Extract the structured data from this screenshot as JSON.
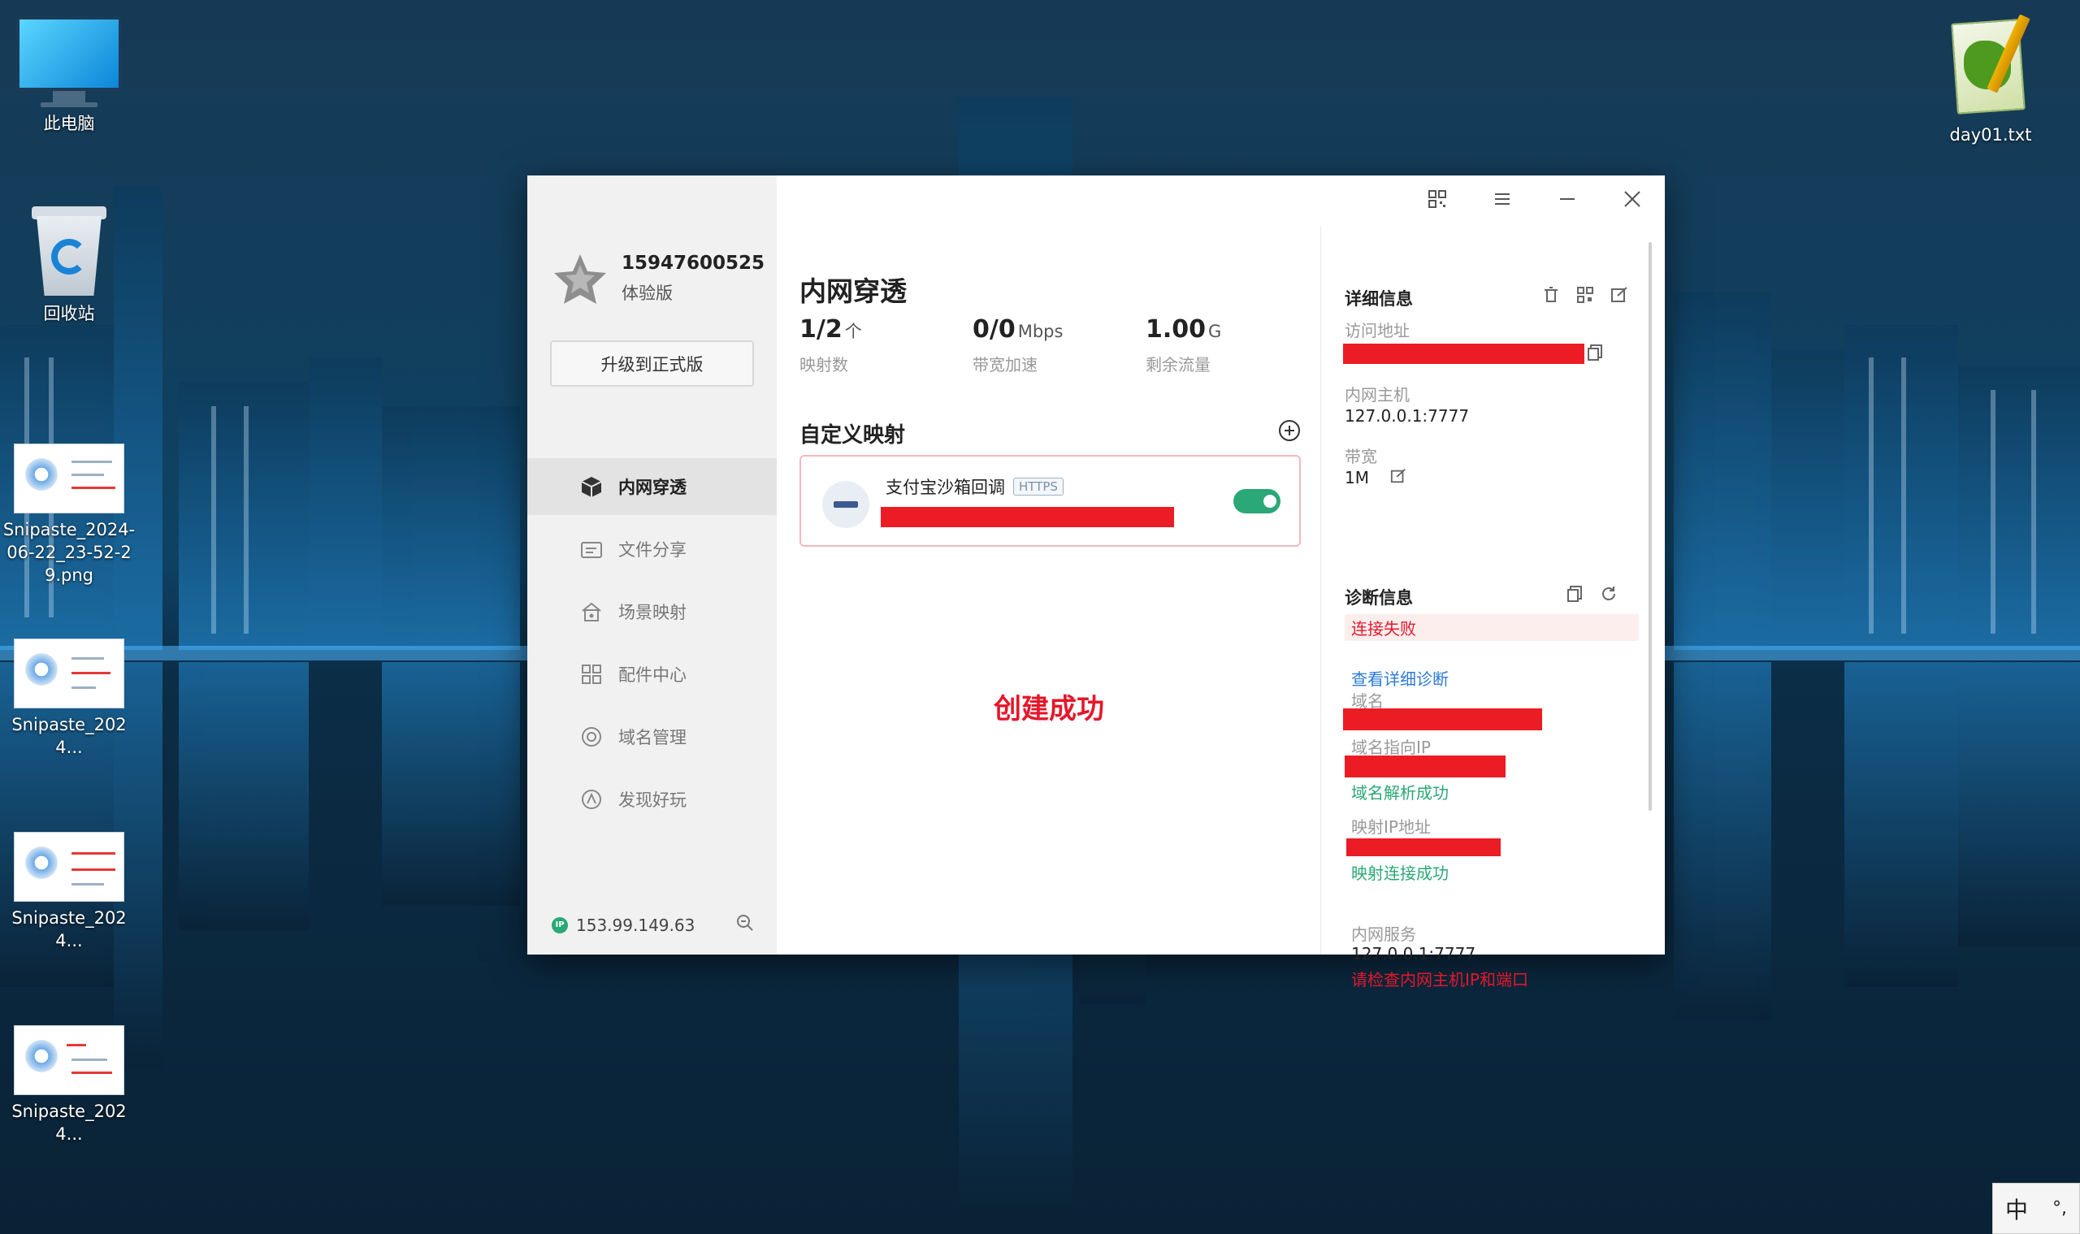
{
  "desktop": {
    "icons": [
      {
        "label": "此电脑"
      },
      {
        "label": "回收站"
      },
      {
        "label": "Snipaste_2024-06-22_23-52-29.png"
      },
      {
        "label": "Snipaste_2024..."
      },
      {
        "label": "Snipaste_2024..."
      },
      {
        "label": "Snipaste_2024..."
      },
      {
        "label": "day01.txt"
      }
    ]
  },
  "app": {
    "profile": {
      "uid": "15947600525",
      "tier": "体验版"
    },
    "upgrade_label": "升级到正式版",
    "nav": [
      {
        "label": "内网穿透",
        "icon": "cube-icon",
        "active": true
      },
      {
        "label": "文件分享",
        "icon": "folder-share-icon"
      },
      {
        "label": "场景映射",
        "icon": "home-scene-icon"
      },
      {
        "label": "配件中心",
        "icon": "grid-apps-icon"
      },
      {
        "label": "域名管理",
        "icon": "domain-icon"
      },
      {
        "label": "发现好玩",
        "icon": "discover-icon"
      }
    ],
    "footer": {
      "ip_badge": "IP",
      "ip": "153.99.149.63"
    },
    "main": {
      "title": "内网穿透",
      "stats": [
        {
          "value": "1/2",
          "unit": "个",
          "label": "映射数"
        },
        {
          "value": "0/0",
          "unit": "Mbps",
          "label": "带宽加速"
        },
        {
          "value": "1.00",
          "unit": "G",
          "label": "剩余流量"
        }
      ],
      "section_title": "自定义映射",
      "mapping": {
        "name": "支付宝沙箱回调",
        "protocol": "HTTPS",
        "enabled": true
      },
      "success_text": "创建成功"
    },
    "detail": {
      "title": "详细信息",
      "access_label": "访问地址",
      "host_label": "内网主机",
      "host_value": "127.0.0.1:7777",
      "bandwidth_label": "带宽",
      "bandwidth_value": "1M",
      "diag_title": "诊断信息",
      "status": "连接失败",
      "view_diag": "查看详细诊断",
      "domain_label": "域名",
      "domain_ip_label": "域名指向IP",
      "domain_ok": "域名解析成功",
      "map_ip_label": "映射IP地址",
      "map_ok": "映射连接成功",
      "service_label": "内网服务",
      "service_value": "127.0.0.1:7777",
      "service_hint": "请检查内网主机IP和端口"
    }
  },
  "ime": {
    "mode": "中",
    "punct": "°,"
  },
  "colors": {
    "accent_green": "#2aa876",
    "error_red": "#e5172a",
    "link_blue": "#2b7bd8"
  }
}
